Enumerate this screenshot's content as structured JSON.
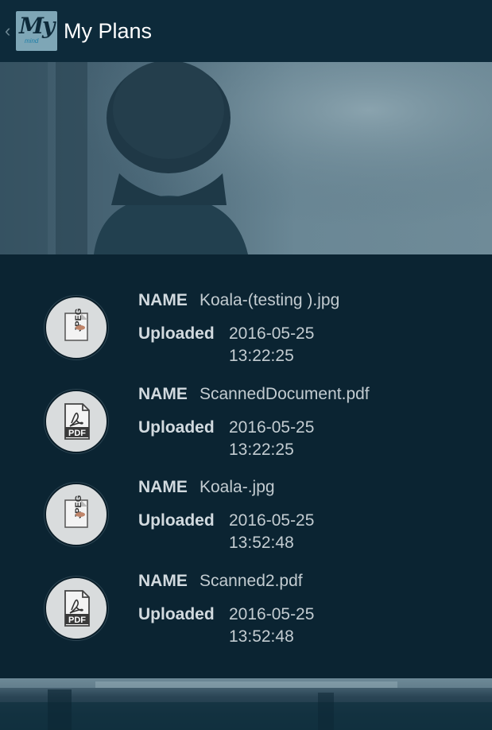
{
  "header": {
    "title": "My Plans",
    "logo_text": "My",
    "logo_subtext": "mind",
    "back_icon": "chevron-left-icon"
  },
  "files": [
    {
      "name_label": "NAME",
      "name": "Koala-(testing ).jpg",
      "uploaded_label": "Uploaded",
      "date": "2016-05-25",
      "time": "13:22:25",
      "type": "jpeg",
      "icon": "jpeg-file-icon"
    },
    {
      "name_label": "NAME",
      "name": "ScannedDocument.pdf",
      "uploaded_label": "Uploaded",
      "date": "2016-05-25",
      "time": "13:22:25",
      "type": "pdf",
      "icon": "pdf-file-icon"
    },
    {
      "name_label": "NAME",
      "name": "Koala-.jpg",
      "uploaded_label": "Uploaded",
      "date": "2016-05-25",
      "time": "13:52:48",
      "type": "jpeg",
      "icon": "jpeg-file-icon"
    },
    {
      "name_label": "NAME",
      "name": "Scanned2.pdf",
      "uploaded_label": "Uploaded",
      "date": "2016-05-25",
      "time": "13:52:48",
      "type": "pdf",
      "icon": "pdf-file-icon"
    }
  ],
  "colors": {
    "background": "#0b2432",
    "topbar": "#0d2a3a",
    "text": "#c3ccd1"
  }
}
